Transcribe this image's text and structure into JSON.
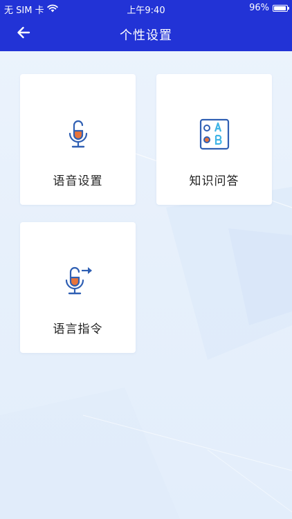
{
  "status_bar": {
    "carrier": "无 SIM 卡",
    "time": "上午9:40",
    "battery": "96%",
    "battery_level": 0.96
  },
  "nav": {
    "title": "个性设置",
    "back_icon": "arrow-left-icon"
  },
  "cards": [
    {
      "label": "语音设置",
      "icon": "microphone-icon"
    },
    {
      "label": "知识问答",
      "icon": "ab-choice-icon"
    },
    {
      "label": "语言指令",
      "icon": "microphone-arrow-icon"
    }
  ],
  "colors": {
    "header": "#2233d6",
    "icon_blue": "#2f5fb3",
    "icon_orange": "#e8743b",
    "icon_cyan": "#3fb4e6",
    "background": "#e7f0fb"
  }
}
